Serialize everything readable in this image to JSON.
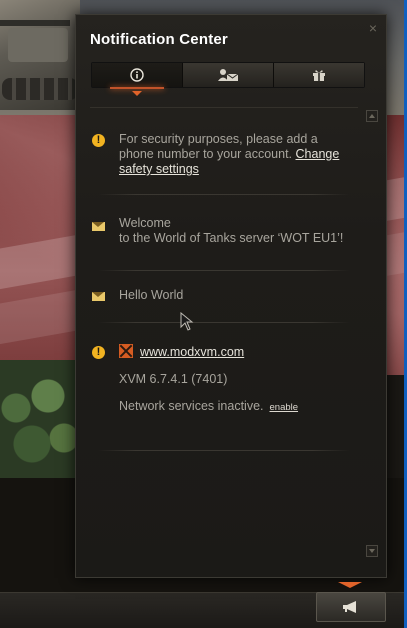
{
  "panel": {
    "title": "Notification Center",
    "close_glyph": "×"
  },
  "tabs": [
    {
      "name": "info",
      "icon": "info-icon"
    },
    {
      "name": "invites",
      "icon": "user-mail-icon"
    },
    {
      "name": "gifts",
      "icon": "gift-icon"
    }
  ],
  "notifications": [
    {
      "type": "warning",
      "icon": "warning-icon",
      "text": "For security purposes, please add a phone number to your account.",
      "link": "Change safety settings"
    },
    {
      "type": "message",
      "icon": "mail-icon",
      "line1": "Welcome",
      "line2": "to the World of Tanks server ‘WOT EU1’!"
    },
    {
      "type": "message",
      "icon": "mail-icon",
      "text": "Hello World"
    },
    {
      "type": "warning",
      "icon": "warning-icon",
      "link": "www.modxvm.com",
      "version": "XVM 6.7.4.1 (7401)",
      "status": "Network services inactive.",
      "status_link": "enable"
    }
  ],
  "colors": {
    "accent": "#e0632a",
    "warning": "#f2b321",
    "text": "#a8a59d"
  }
}
